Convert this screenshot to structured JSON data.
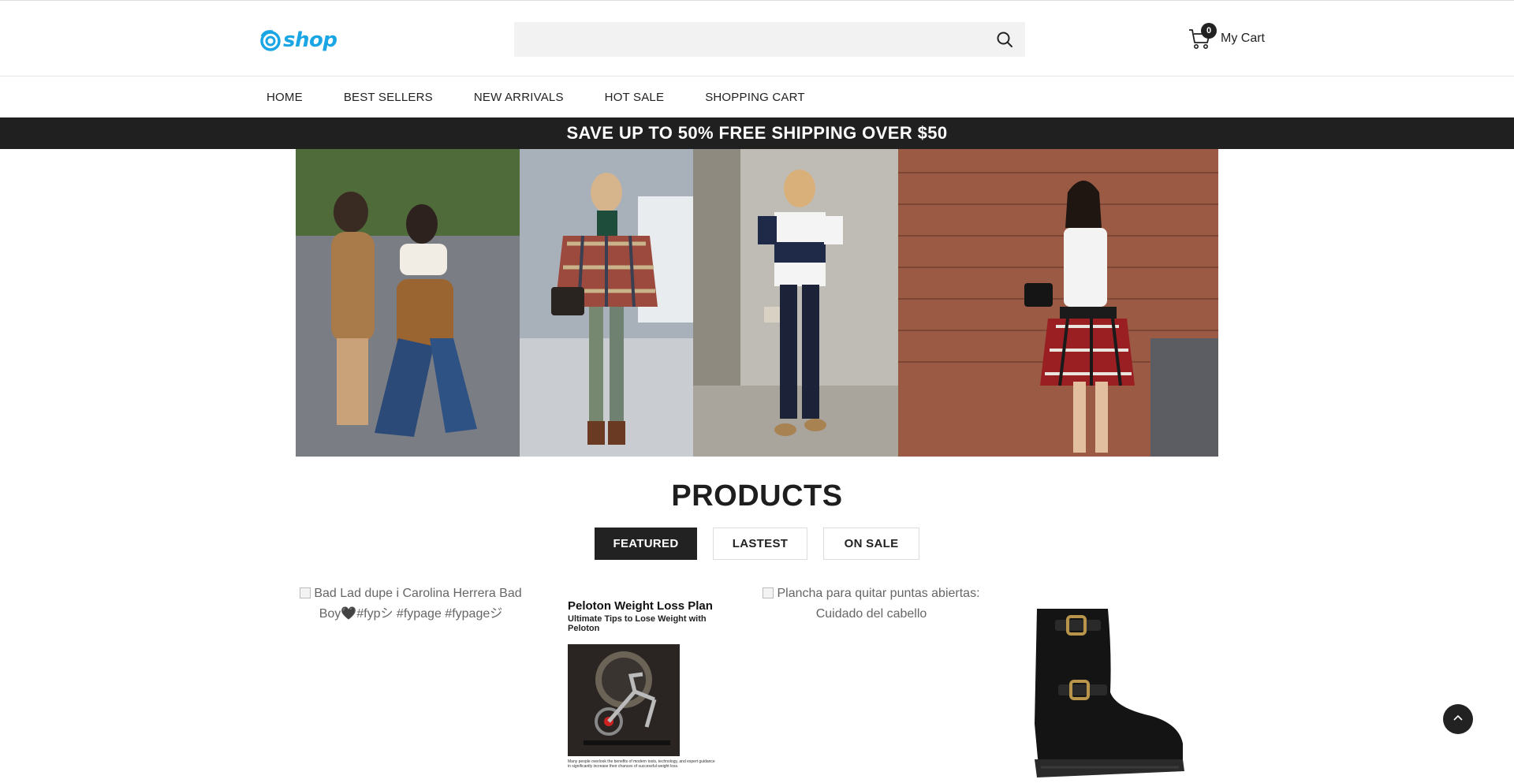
{
  "header": {
    "logo_text": "shop",
    "search": {
      "placeholder": "",
      "value": ""
    },
    "cart": {
      "count": "0",
      "label": "My Cart"
    }
  },
  "nav": {
    "items": [
      "HOME",
      "BEST SELLERS",
      "NEW ARRIVALS",
      "HOT SALE",
      "SHOPPING CART"
    ]
  },
  "promo": {
    "text": "SAVE UP TO 50% FREE SHIPPING OVER $50"
  },
  "banner": {
    "photos": [
      "street-style-duo",
      "plaid-poncho-look",
      "striped-tee-look",
      "flannel-waist-look"
    ]
  },
  "products": {
    "title": "PRODUCTS",
    "tabs": [
      {
        "label": "FEATURED",
        "active": true
      },
      {
        "label": "LASTEST",
        "active": false
      },
      {
        "label": "ON SALE",
        "active": false
      }
    ],
    "items": [
      {
        "alt": "Bad Lad dupe i Carolina Herrera Bad Boy🖤#fypシ #fypage #fypageジ"
      },
      {
        "book_title": "Peloton Weight Loss Plan",
        "book_subtitle": "Ultimate Tips to Lose Weight with Peloton",
        "book_footer": "Many people overlook the benefits of modern tools, technology, and expert guidance in significantly increase their chances of successful weight loss."
      },
      {
        "alt": "Plancha para quitar puntas abiertas: Cuidado del cabello"
      },
      {
        "image": "black-ankle-boot"
      }
    ]
  },
  "colors": {
    "brand": "#1aa6e4",
    "dark": "#202020"
  }
}
